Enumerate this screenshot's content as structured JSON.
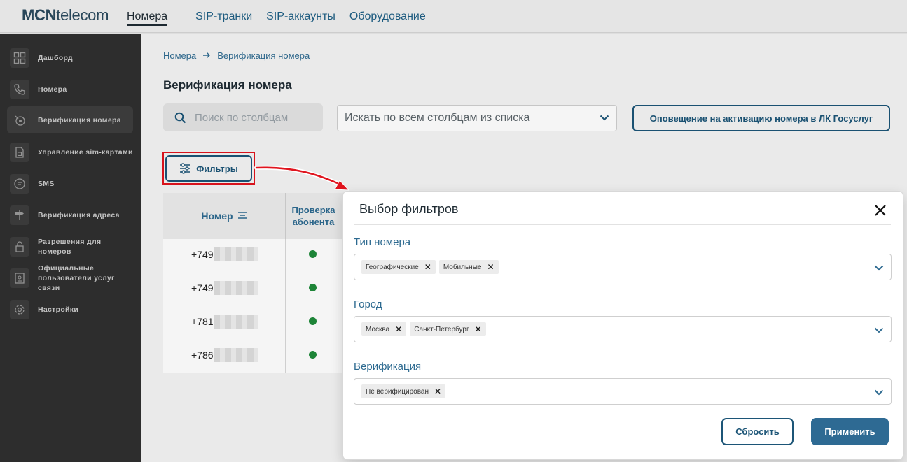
{
  "app": {
    "logo_bold": "MCN",
    "logo_light": "telecom"
  },
  "topnav": {
    "items": [
      "Номера",
      "SIP-транки",
      "SIP-аккаунты",
      "Оборудование"
    ],
    "active": "Номера"
  },
  "sidebar": {
    "items": [
      {
        "label": "Дашборд",
        "icon": "dashboard-icon"
      },
      {
        "label": "Номера",
        "icon": "phone-icon"
      },
      {
        "label": "Верификация номера",
        "icon": "verify-icon",
        "active": true
      },
      {
        "label": "Управление sim-картами",
        "icon": "sim-icon"
      },
      {
        "label": "SMS",
        "icon": "sms-icon"
      },
      {
        "label": "Верификация адреса",
        "icon": "signpost-icon"
      },
      {
        "label": "Разрешения для номеров",
        "icon": "lock-icon"
      },
      {
        "label": "Официальные пользователи услуг связи",
        "icon": "badge-icon"
      },
      {
        "label": "Настройки",
        "icon": "gear-icon"
      }
    ]
  },
  "breadcrumb": {
    "root": "Номера",
    "current": "Верификация номера"
  },
  "page": {
    "title": "Верификация номера"
  },
  "search": {
    "placeholder": "Поиск по столбцам"
  },
  "column_select": {
    "value": "Искать по всем столбцам из списка"
  },
  "notify_button": "Оповещение на активацию номера в ЛК Госуслуг",
  "filters_button": "Фильтры",
  "table": {
    "headers": {
      "number": "Номер",
      "check": "Проверка абонента"
    },
    "rows": [
      {
        "prefix": "+749",
        "status": "ok"
      },
      {
        "prefix": "+749",
        "status": "ok"
      },
      {
        "prefix": "+781",
        "status": "ok"
      },
      {
        "prefix": "+786",
        "status": "ok"
      }
    ]
  },
  "modal": {
    "title": "Выбор фильтров",
    "fields": [
      {
        "label": "Тип номера",
        "chips": [
          "Географические",
          "Мобильные"
        ]
      },
      {
        "label": "Город",
        "chips": [
          "Москва",
          "Санкт-Петербург"
        ]
      },
      {
        "label": "Верификация",
        "chips": [
          "Не верифицирован"
        ]
      }
    ],
    "reset_label": "Сбросить",
    "apply_label": "Применить"
  },
  "colors": {
    "accent": "#1c5577",
    "primary_button": "#2e6a93",
    "highlight": "#e0141e",
    "status_ok": "#1f8a3a"
  }
}
